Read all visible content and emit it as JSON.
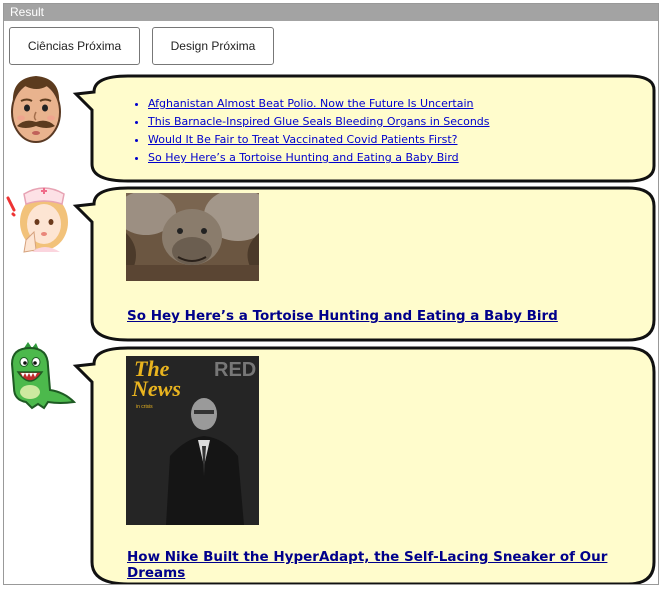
{
  "window": {
    "title": "Result"
  },
  "buttons": {
    "ciencias": "Ciências Próxima",
    "design": "Design Próxima"
  },
  "avatars": [
    "mustache-man-icon",
    "nurse-alarmed-icon",
    "green-dinosaur-icon"
  ],
  "bubble1": {
    "links": [
      "Afghanistan Almost Beat Polio. Now the Future Is Uncertain",
      "This Barnacle-Inspired Glue Seals Bleeding Organs in Seconds",
      "Would It Be Fair to Treat Vaccinated Covid Patients First?",
      "So Hey Here’s a Tortoise Hunting and Eating a Baby Bird"
    ]
  },
  "bubble2": {
    "caption": "So Hey Here’s a Tortoise Hunting and Eating a Baby Bird"
  },
  "bubble3": {
    "caption": "How Nike Built the HyperAdapt, the Self-Lacing Sneaker of Our Dreams",
    "cover": {
      "masthead": "RED",
      "title_line1": "The",
      "title_line2": "News",
      "subtitle": "in crisis"
    }
  },
  "colors": {
    "bubble_fill": "#fffccc",
    "link": "#00008b",
    "titlebar": "#a3a3a3"
  }
}
